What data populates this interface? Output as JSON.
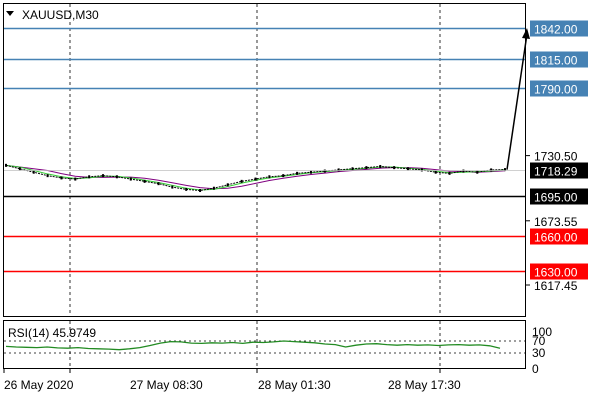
{
  "chart_data": {
    "type": "candlestick",
    "symbol_label": "XAUUSD,M30",
    "price_axis_ticks": [
      {
        "value": 1730.5,
        "label": "1730.50"
      },
      {
        "value": 1673.55,
        "label": "1673.55"
      },
      {
        "value": 1617.45,
        "label": "1617.45"
      }
    ],
    "current_price": {
      "value": 1718.29,
      "label": "1718.29"
    },
    "levels": [
      {
        "value": 1842.0,
        "label": "1842.00",
        "color": "#4682b4"
      },
      {
        "value": 1815.0,
        "label": "1815.00",
        "color": "#4682b4"
      },
      {
        "value": 1790.0,
        "label": "1790.00",
        "color": "#4682b4"
      },
      {
        "value": 1695.0,
        "label": "1695.00",
        "color": "#000000"
      },
      {
        "value": 1660.0,
        "label": "1660.00",
        "color": "#ff0000"
      },
      {
        "value": 1630.0,
        "label": "1630.00",
        "color": "#ff0000"
      }
    ],
    "price_series": [
      1722,
      1719,
      1716,
      1713,
      1711,
      1710,
      1712,
      1713,
      1712,
      1710,
      1708,
      1706,
      1703,
      1701,
      1700,
      1702,
      1705,
      1708,
      1710,
      1712,
      1713,
      1715,
      1716,
      1717,
      1718,
      1719,
      1720,
      1721,
      1720,
      1719,
      1718,
      1716,
      1715,
      1717,
      1716,
      1718,
      1718.29
    ],
    "forecast_arrow": {
      "from": 1718.29,
      "to": 1842.0
    },
    "time_axis_labels": [
      "26 May 2020",
      "27 May 08:30",
      "28 May 01:30",
      "28 May 17:30"
    ],
    "rsi": {
      "label": "RSI(14) 45.9749",
      "axis_ticks": [
        "100",
        "70",
        "30",
        "0"
      ],
      "levels": [
        70,
        30
      ],
      "values": [
        52,
        50,
        49,
        48,
        50,
        47,
        46,
        48,
        45,
        44,
        43,
        41,
        44,
        48,
        55,
        63,
        68,
        67,
        63,
        62,
        64,
        63,
        65,
        62,
        66,
        65,
        67,
        70,
        68,
        66,
        64,
        60,
        58,
        50,
        56,
        60,
        61,
        58,
        56,
        58,
        56,
        57,
        55,
        57,
        58,
        56,
        57,
        54,
        46
      ]
    },
    "colors": {
      "line": "#000000",
      "ma_1": "#800080",
      "ma_2": "#32cd32",
      "rsi": "#228b22"
    }
  }
}
